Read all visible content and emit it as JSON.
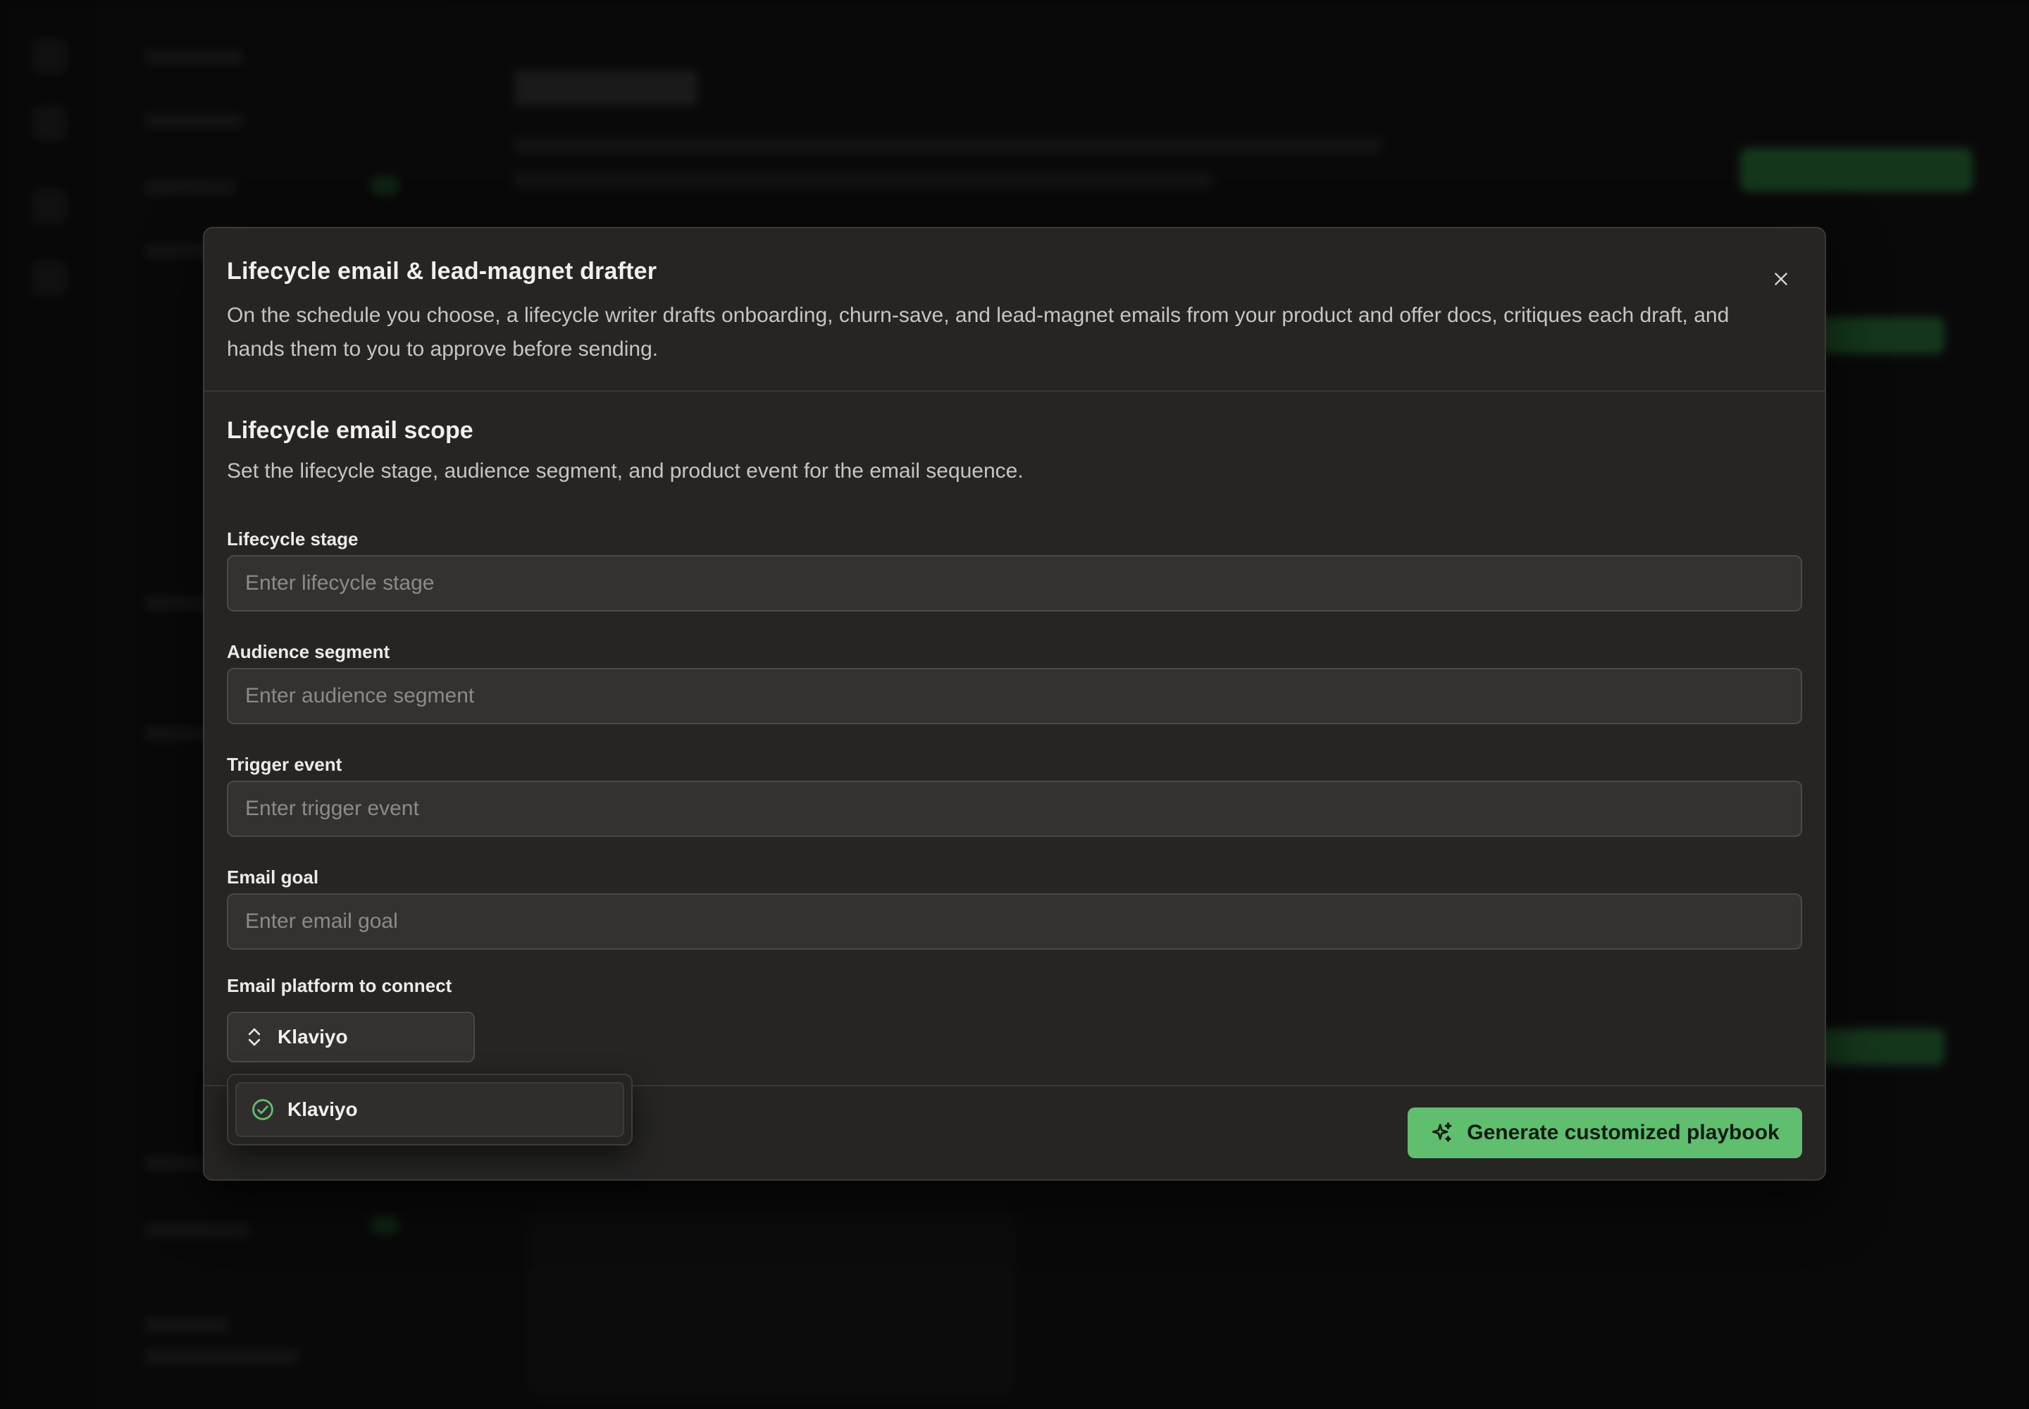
{
  "modal": {
    "title": "Lifecycle email & lead-magnet drafter",
    "description": "On the schedule you choose, a lifecycle writer drafts onboarding, churn-save, and lead-magnet emails from your product and offer docs, critiques each draft, and hands them to you to approve before sending.",
    "close_icon": "close-icon"
  },
  "section": {
    "title": "Lifecycle email scope",
    "description": "Set the lifecycle stage, audience segment, and product event for the email sequence."
  },
  "fields": {
    "lifecycle_stage": {
      "label": "Lifecycle stage",
      "value": "",
      "placeholder": "Enter lifecycle stage"
    },
    "audience_segment": {
      "label": "Audience segment",
      "value": "",
      "placeholder": "Enter audience segment"
    },
    "trigger_event": {
      "label": "Trigger event",
      "value": "",
      "placeholder": "Enter trigger event"
    },
    "email_goal": {
      "label": "Email goal",
      "value": "",
      "placeholder": "Enter email goal"
    },
    "email_platform": {
      "label": "Email platform to connect",
      "selected": "Klaviyo",
      "options": [
        {
          "label": "Klaviyo",
          "selected": true
        }
      ]
    }
  },
  "footer": {
    "generate_label": "Generate customized playbook",
    "generate_icon": "sparkles-icon"
  },
  "colors": {
    "accent_green": "#5fbf6f",
    "modal_bg": "#262524",
    "input_bg": "#333231",
    "check_green": "#5fbf6f"
  }
}
